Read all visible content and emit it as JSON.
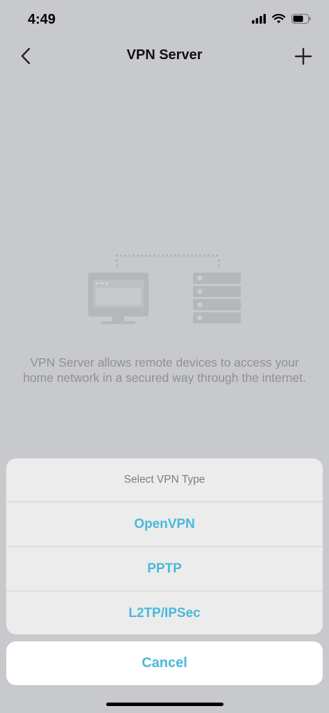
{
  "status_bar": {
    "time": "4:49",
    "icons": [
      "cellular-signal-icon",
      "wifi-icon",
      "battery-icon"
    ]
  },
  "nav": {
    "title": "VPN Server",
    "back_icon": "chevron-left-icon",
    "add_icon": "plus-icon"
  },
  "illustration": {
    "icons": [
      "computer-monitor-icon",
      "server-stack-icon"
    ]
  },
  "description": "VPN Server allows remote devices to access your home network in a secured way through the internet.",
  "sheet": {
    "title": "Select VPN Type",
    "options": [
      {
        "label": "OpenVPN"
      },
      {
        "label": "PPTP"
      },
      {
        "label": "L2TP/IPSec"
      }
    ],
    "cancel_label": "Cancel"
  },
  "colors": {
    "accent": "#4ab9d9",
    "overlay_background": "#c8c9cc",
    "sheet_background": "#ececed"
  }
}
